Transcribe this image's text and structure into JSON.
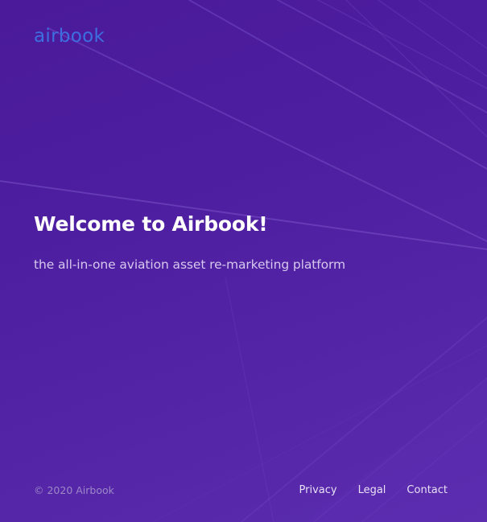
{
  "brand": {
    "logo_text": "airbook",
    "logo_color": "#3d6fe0"
  },
  "hero": {
    "title": "Welcome to Airbook!",
    "subtitle": "the all-in-one aviation asset re-marketing platform"
  },
  "footer": {
    "copyright": "© 2020 Airbook",
    "links": [
      {
        "label": "Privacy"
      },
      {
        "label": "Legal"
      },
      {
        "label": "Contact"
      }
    ]
  },
  "colors": {
    "background": "#4d1ea0",
    "title": "#ffffff",
    "subtitle": "#d6c8ee",
    "copyright": "#9d88c8",
    "link": "#e8e0f6"
  }
}
